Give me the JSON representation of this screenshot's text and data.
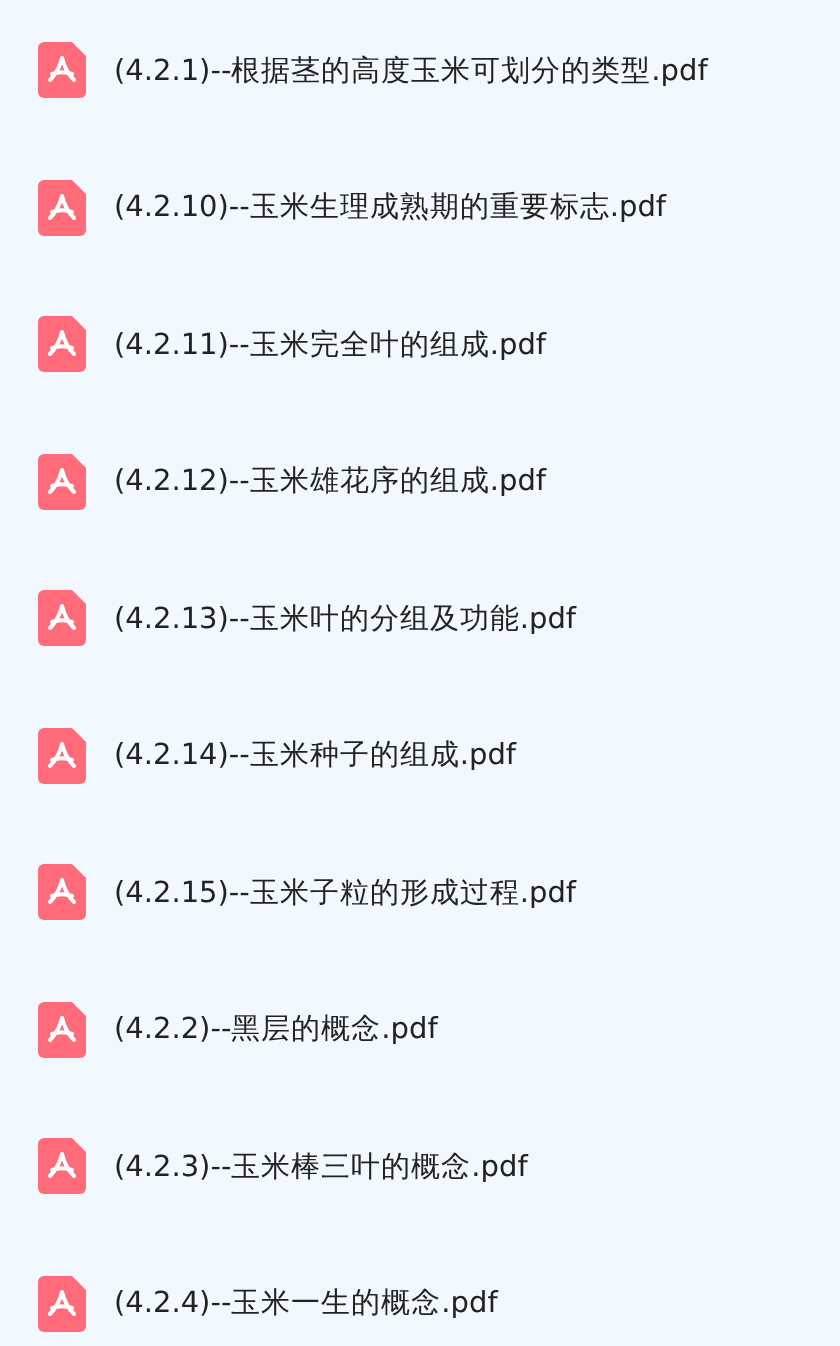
{
  "files": [
    {
      "name": "(4.2.1)--根据茎的高度玉米可划分的类型.pdf"
    },
    {
      "name": "(4.2.10)--玉米生理成熟期的重要标志.pdf"
    },
    {
      "name": "(4.2.11)--玉米完全叶的组成.pdf"
    },
    {
      "name": "(4.2.12)--玉米雄花序的组成.pdf"
    },
    {
      "name": "(4.2.13)--玉米叶的分组及功能.pdf"
    },
    {
      "name": "(4.2.14)--玉米种子的组成.pdf"
    },
    {
      "name": "(4.2.15)--玉米子粒的形成过程.pdf"
    },
    {
      "name": "(4.2.2)--黑层的概念.pdf"
    },
    {
      "name": "(4.2.3)--玉米棒三叶的概念.pdf"
    },
    {
      "name": "(4.2.4)--玉米一生的概念.pdf"
    }
  ]
}
